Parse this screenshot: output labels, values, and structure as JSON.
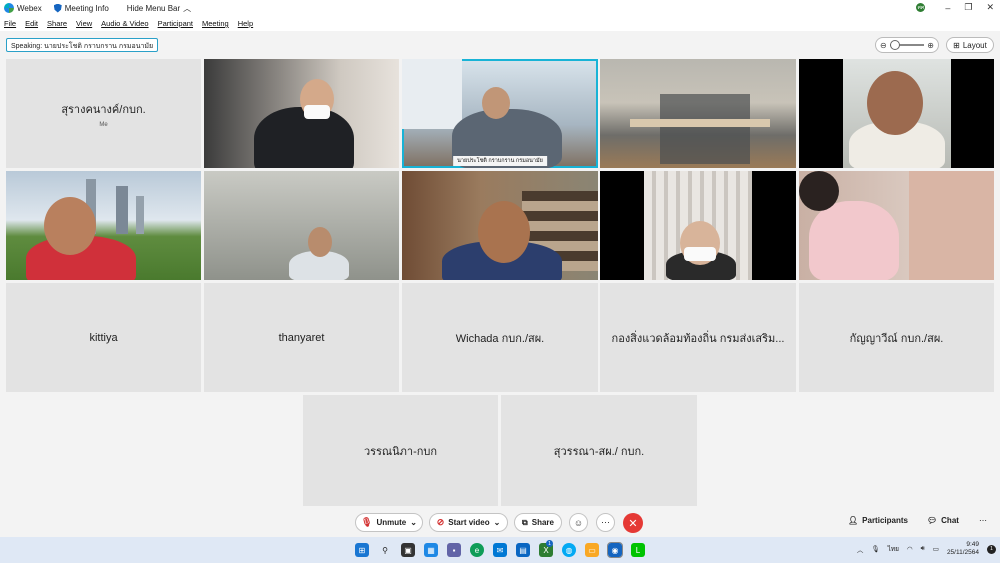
{
  "titlebar": {
    "app_name": "Webex",
    "meeting_info": "Meeting Info",
    "hide_menu": "Hide Menu Bar",
    "avatar_initials": "ศศ"
  },
  "menu": [
    "File",
    "Edit",
    "Share",
    "View",
    "Audio & Video",
    "Participant",
    "Meeting",
    "Help"
  ],
  "speaking": "Speaking: นายประโชติ กราบกราน กรมอนามัย",
  "layout_label": "Layout",
  "tiles": {
    "t1_name": "สุรางคนางค์/กบก.",
    "t1_me": "Me",
    "t3_label": "นายประโชติ กราบกราน กรมอนามัย",
    "n1": "kittiya",
    "n2": "thanyaret",
    "n3": "Wichada กบก./สผ.",
    "n4": "กองสิ่งแวดล้อมท้องถิ่น กรมส่งเสริม...",
    "n5": "กัญญาวีณ์ กบก./สผ.",
    "n6": "วรรณนิภา-กบก",
    "n7": "สุวรรณา-สผ./ กบก."
  },
  "controls": {
    "unmute": "Unmute",
    "start_video": "Start video",
    "share": "Share",
    "participants": "Participants",
    "chat": "Chat"
  },
  "taskbar": {
    "lang": "ไทย",
    "time": "9:49",
    "date": "25/11/2564",
    "notif_count": "1",
    "badge_count": "1"
  },
  "colors": {
    "accent": "#18b3d6",
    "end_call": "#e53935",
    "mute_red": "#d32f2f"
  }
}
